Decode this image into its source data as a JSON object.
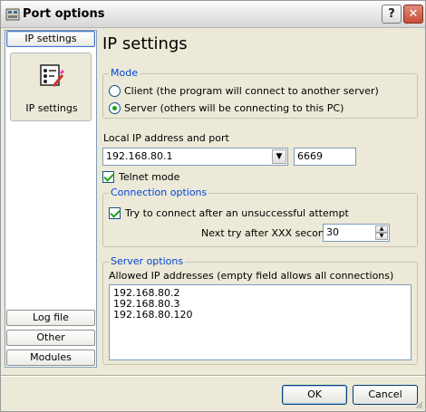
{
  "window": {
    "title": "Port options",
    "help_label": "?",
    "close_label": "✕"
  },
  "sidebar": {
    "top_button": "IP settings",
    "panel_item_label": "IP settings",
    "log_file": "Log file",
    "other": "Other",
    "modules": "Modules"
  },
  "main": {
    "title": "IP settings",
    "mode": {
      "legend": "Mode",
      "client_label": "Client (the program will connect to another server)",
      "server_label": "Server (others will be connecting to this PC)",
      "selected": "server"
    },
    "local_ip": {
      "label": "Local IP address and port",
      "address": "192.168.80.1",
      "port": "6669"
    },
    "telnet_mode": {
      "label": "Telnet mode",
      "checked": true
    },
    "connection_options": {
      "legend": "Connection options",
      "retry_label": "Try to connect after an unsuccessful attempt",
      "retry_checked": true,
      "next_try_label": "Next try after XXX seconds",
      "next_try_value": "30"
    },
    "server_options": {
      "legend": "Server options",
      "allowed_label": "Allowed IP addresses (empty field allows all connections)",
      "addresses": [
        "192.168.80.2",
        "192.168.80.3",
        "192.168.80.120"
      ]
    }
  },
  "footer": {
    "ok_label": "OK",
    "cancel_label": "Cancel"
  },
  "colors": {
    "legend_text": "#0046d5",
    "window_bg": "#ece9d8",
    "check_mark": "#21a121"
  }
}
